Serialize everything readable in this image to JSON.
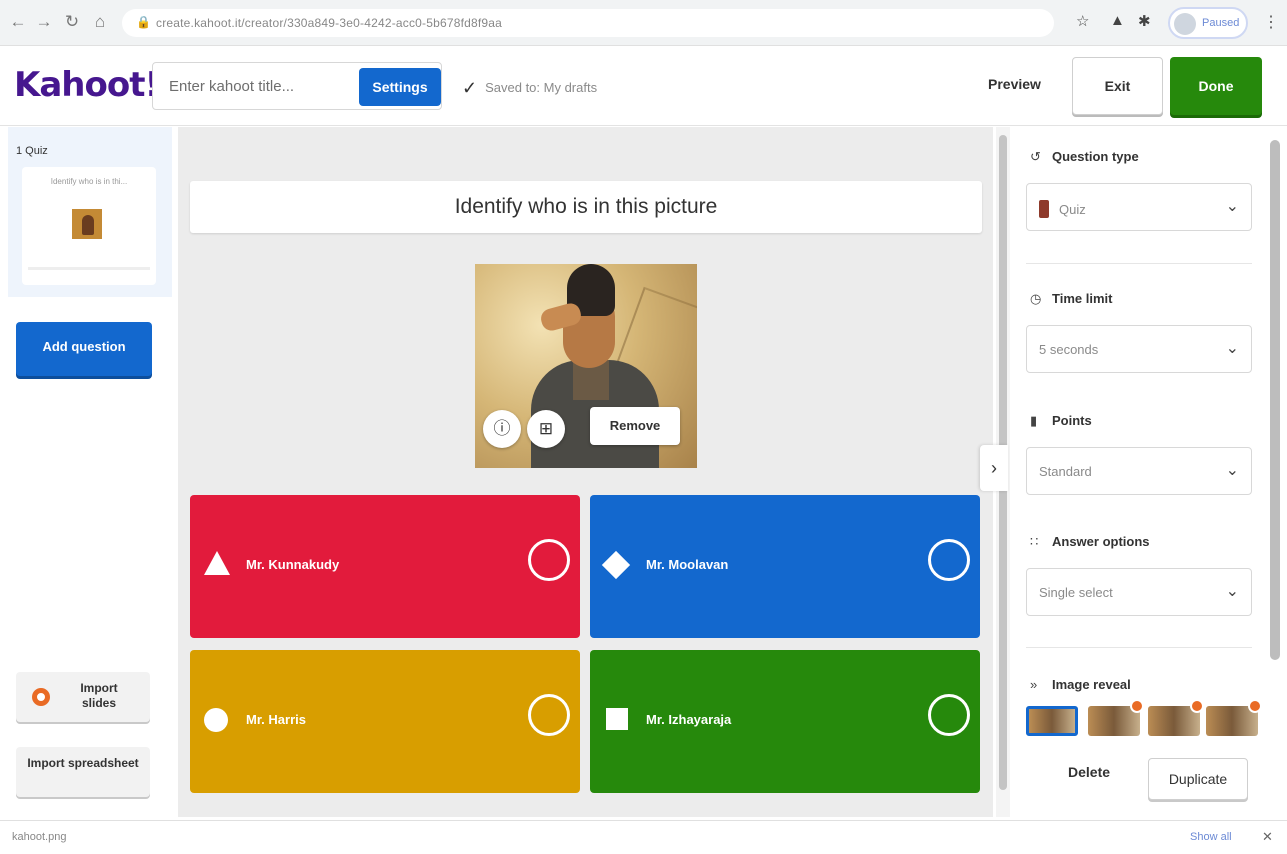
{
  "browser": {
    "url": "create.kahoot.it/creator/330a849-3e0-4242-acc0-5b678fd8f9aa",
    "profile": "Paused",
    "icons": [
      "back-icon",
      "forward-icon",
      "reload-icon",
      "home-icon",
      "lock-icon",
      "star-icon",
      "extension-icon",
      "puzzle-icon",
      "more-icon"
    ]
  },
  "header": {
    "logo": "Kahoot",
    "logo_bang": "!",
    "title_placeholder": "Enter kahoot title...",
    "settings_label": "Settings",
    "saved_status": "Saved to: My drafts",
    "preview_label": "Preview",
    "exit_label": "Exit",
    "done_label": "Done"
  },
  "sidebar": {
    "slide_label": "1  Quiz",
    "slide_title": "Identify who is in thi...",
    "add_question_label": "Add question",
    "import_slides_label": "Import slides",
    "import_spreadsheet_label": "Import spreadsheet"
  },
  "canvas": {
    "question": "Identify who is in this picture",
    "remove_label": "Remove",
    "answers": [
      {
        "text": "Mr. Kunnakudy",
        "shape": "triangle",
        "color": "#e21b3c"
      },
      {
        "text": "Mr. Moolavan",
        "shape": "diamond",
        "color": "#1368ce"
      },
      {
        "text": "Mr. Harris",
        "shape": "circle",
        "color": "#d89e00"
      },
      {
        "text": "Mr. Izhayaraja",
        "shape": "square",
        "color": "#26890c"
      }
    ]
  },
  "panel": {
    "question_type_label": "Question type",
    "question_type_value": "Quiz",
    "time_limit_label": "Time limit",
    "time_limit_value": "5 seconds",
    "points_label": "Points",
    "points_value": "Standard",
    "answer_options_label": "Answer options",
    "answer_options_value": "Single select",
    "image_reveal_label": "Image reveal",
    "delete_label": "Delete",
    "duplicate_label": "Duplicate"
  },
  "footer": {
    "download_label": "kahoot.png",
    "show_all_label": "Show all"
  },
  "colors": {
    "brand": "#46178f",
    "accent_blue": "#1368ce",
    "done_green": "#26890c"
  }
}
